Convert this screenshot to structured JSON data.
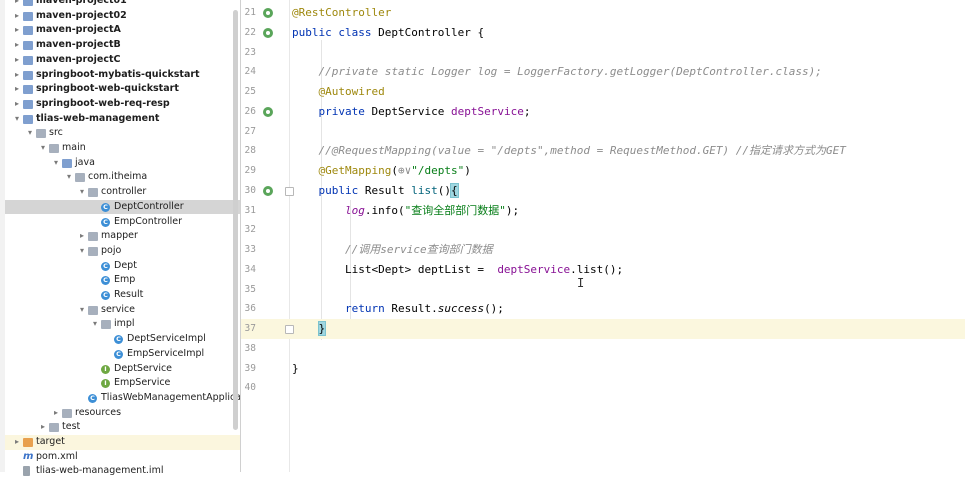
{
  "project_tree": {
    "items": [
      {
        "label": "maven-project01",
        "icon": "module-icon",
        "arrow": "▸",
        "bold": true
      },
      {
        "label": "maven-project02",
        "icon": "module-icon",
        "arrow": "▸",
        "bold": true
      },
      {
        "label": "maven-projectA",
        "icon": "module-icon",
        "arrow": "▸",
        "bold": true
      },
      {
        "label": "maven-projectB",
        "icon": "module-icon",
        "arrow": "▸",
        "bold": true
      },
      {
        "label": "maven-projectC",
        "icon": "module-icon",
        "arrow": "▸",
        "bold": true
      },
      {
        "label": "springboot-mybatis-quickstart",
        "icon": "module-icon",
        "arrow": "▸",
        "bold": true
      },
      {
        "label": "springboot-web-quickstart",
        "icon": "module-icon",
        "arrow": "▸",
        "bold": true
      },
      {
        "label": "springboot-web-req-resp",
        "icon": "module-icon",
        "arrow": "▸",
        "bold": true
      },
      {
        "label": "tlias-web-management",
        "icon": "module-icon",
        "arrow": "▾",
        "bold": true
      },
      {
        "label": "src",
        "icon": "folder-icon",
        "arrow": "▾"
      },
      {
        "label": "main",
        "icon": "folder-icon",
        "arrow": "▾"
      },
      {
        "label": "java",
        "icon": "source-folder-icon",
        "arrow": "▾"
      },
      {
        "label": "com.itheima",
        "icon": "package-icon",
        "arrow": "▾"
      },
      {
        "label": "controller",
        "icon": "package-icon",
        "arrow": "▾"
      },
      {
        "label": "DeptController",
        "icon": "class-icon",
        "selected": true
      },
      {
        "label": "EmpController",
        "icon": "class-icon"
      },
      {
        "label": "mapper",
        "icon": "package-icon",
        "arrow": "▸"
      },
      {
        "label": "pojo",
        "icon": "package-icon",
        "arrow": "▾"
      },
      {
        "label": "Dept",
        "icon": "class-icon"
      },
      {
        "label": "Emp",
        "icon": "class-icon"
      },
      {
        "label": "Result",
        "icon": "class-icon"
      },
      {
        "label": "service",
        "icon": "package-icon",
        "arrow": "▾"
      },
      {
        "label": "impl",
        "icon": "package-icon",
        "arrow": "▾"
      },
      {
        "label": "DeptServiceImpl",
        "icon": "class-icon"
      },
      {
        "label": "EmpServiceImpl",
        "icon": "class-icon"
      },
      {
        "label": "DeptService",
        "icon": "interface-icon"
      },
      {
        "label": "EmpService",
        "icon": "interface-icon"
      },
      {
        "label": "TliasWebManagementApplication",
        "icon": "spring-app-icon"
      },
      {
        "label": "resources",
        "icon": "folder-icon",
        "arrow": "▸"
      },
      {
        "label": "test",
        "icon": "folder-icon",
        "arrow": "▸"
      },
      {
        "label": "target",
        "icon": "target-folder-icon",
        "arrow": "▸",
        "highlight": true
      },
      {
        "label": "pom.xml",
        "icon": "maven-file-icon"
      },
      {
        "label": "tlias-web-management.iml",
        "icon": "iml-file-icon"
      }
    ]
  },
  "editor": {
    "lines": [
      {
        "num": "21",
        "gutter": "bean-icon",
        "tokens": [
          [
            "@RestController",
            "ann"
          ]
        ]
      },
      {
        "num": "22",
        "gutter": "bean-icon",
        "tokens": [
          [
            "public ",
            "kw"
          ],
          [
            "class ",
            "kw"
          ],
          [
            "DeptController {",
            ""
          ]
        ]
      },
      {
        "num": "23",
        "tokens": []
      },
      {
        "num": "24",
        "tokens": [
          [
            "    ",
            ""
          ],
          [
            "//private static Logger log = LoggerFactory.getLogger(DeptController.class);",
            "cmt"
          ]
        ]
      },
      {
        "num": "25",
        "tokens": [
          [
            "    ",
            ""
          ],
          [
            "@Autowired",
            "ann"
          ]
        ]
      },
      {
        "num": "26",
        "gutter": "bean-icon",
        "tokens": [
          [
            "    ",
            ""
          ],
          [
            "private ",
            "kw"
          ],
          [
            "DeptService ",
            ""
          ],
          [
            "deptService",
            "fld"
          ],
          [
            ";",
            ""
          ]
        ]
      },
      {
        "num": "27",
        "tokens": []
      },
      {
        "num": "28",
        "tokens": [
          [
            "    ",
            ""
          ],
          [
            "//@RequestMapping(value = \"/depts\",method = RequestMethod.GET) //指定请求方式为GET",
            "cmt"
          ]
        ]
      },
      {
        "num": "29",
        "tokens": [
          [
            "    ",
            ""
          ],
          [
            "@GetMapping",
            "ann"
          ],
          [
            "(",
            ""
          ],
          [
            "⊕∨",
            "cmt"
          ],
          [
            "\"/depts\"",
            "str"
          ],
          [
            ")",
            ""
          ]
        ]
      },
      {
        "num": "30",
        "gutter": "bean-icon",
        "fold": true,
        "tokens": [
          [
            "    ",
            ""
          ],
          [
            "public ",
            "kw"
          ],
          [
            "Result ",
            ""
          ],
          [
            "list",
            "mth"
          ],
          [
            "()",
            ""
          ],
          [
            "{",
            "brace"
          ]
        ]
      },
      {
        "num": "31",
        "tokens": [
          [
            "        ",
            ""
          ],
          [
            "log",
            "fld i"
          ],
          [
            ".info(",
            ""
          ],
          [
            "\"查询全部部门数据\"",
            "str"
          ],
          [
            ");",
            ""
          ]
        ]
      },
      {
        "num": "32",
        "tokens": []
      },
      {
        "num": "33",
        "tokens": [
          [
            "        ",
            ""
          ],
          [
            "//调用service查询部门数据",
            "cmt"
          ]
        ]
      },
      {
        "num": "34",
        "tokens": [
          [
            "        ",
            ""
          ],
          [
            "List<Dept> deptList =  ",
            ""
          ],
          [
            "deptService",
            "fld"
          ],
          [
            ".list();",
            ""
          ]
        ]
      },
      {
        "num": "35",
        "tokens": []
      },
      {
        "num": "36",
        "tokens": [
          [
            "        ",
            ""
          ],
          [
            "return ",
            "kw"
          ],
          [
            "Result.",
            ""
          ],
          [
            "success",
            "it"
          ],
          [
            "();",
            ""
          ]
        ]
      },
      {
        "num": "37",
        "fold": true,
        "current": true,
        "tokens": [
          [
            "    ",
            ""
          ],
          [
            "}",
            "brace"
          ]
        ]
      },
      {
        "num": "38",
        "tokens": []
      },
      {
        "num": "39",
        "tokens": [
          [
            "}",
            ""
          ]
        ]
      },
      {
        "num": "40",
        "tokens": []
      }
    ]
  },
  "colors": {
    "annotation": "#9e880d",
    "keyword": "#0033b3",
    "comment": "#8c8c8c",
    "string": "#067d17",
    "field": "#871094",
    "method": "#00627a",
    "selection": "#d5d5d5",
    "current_line": "#fbf7de"
  }
}
